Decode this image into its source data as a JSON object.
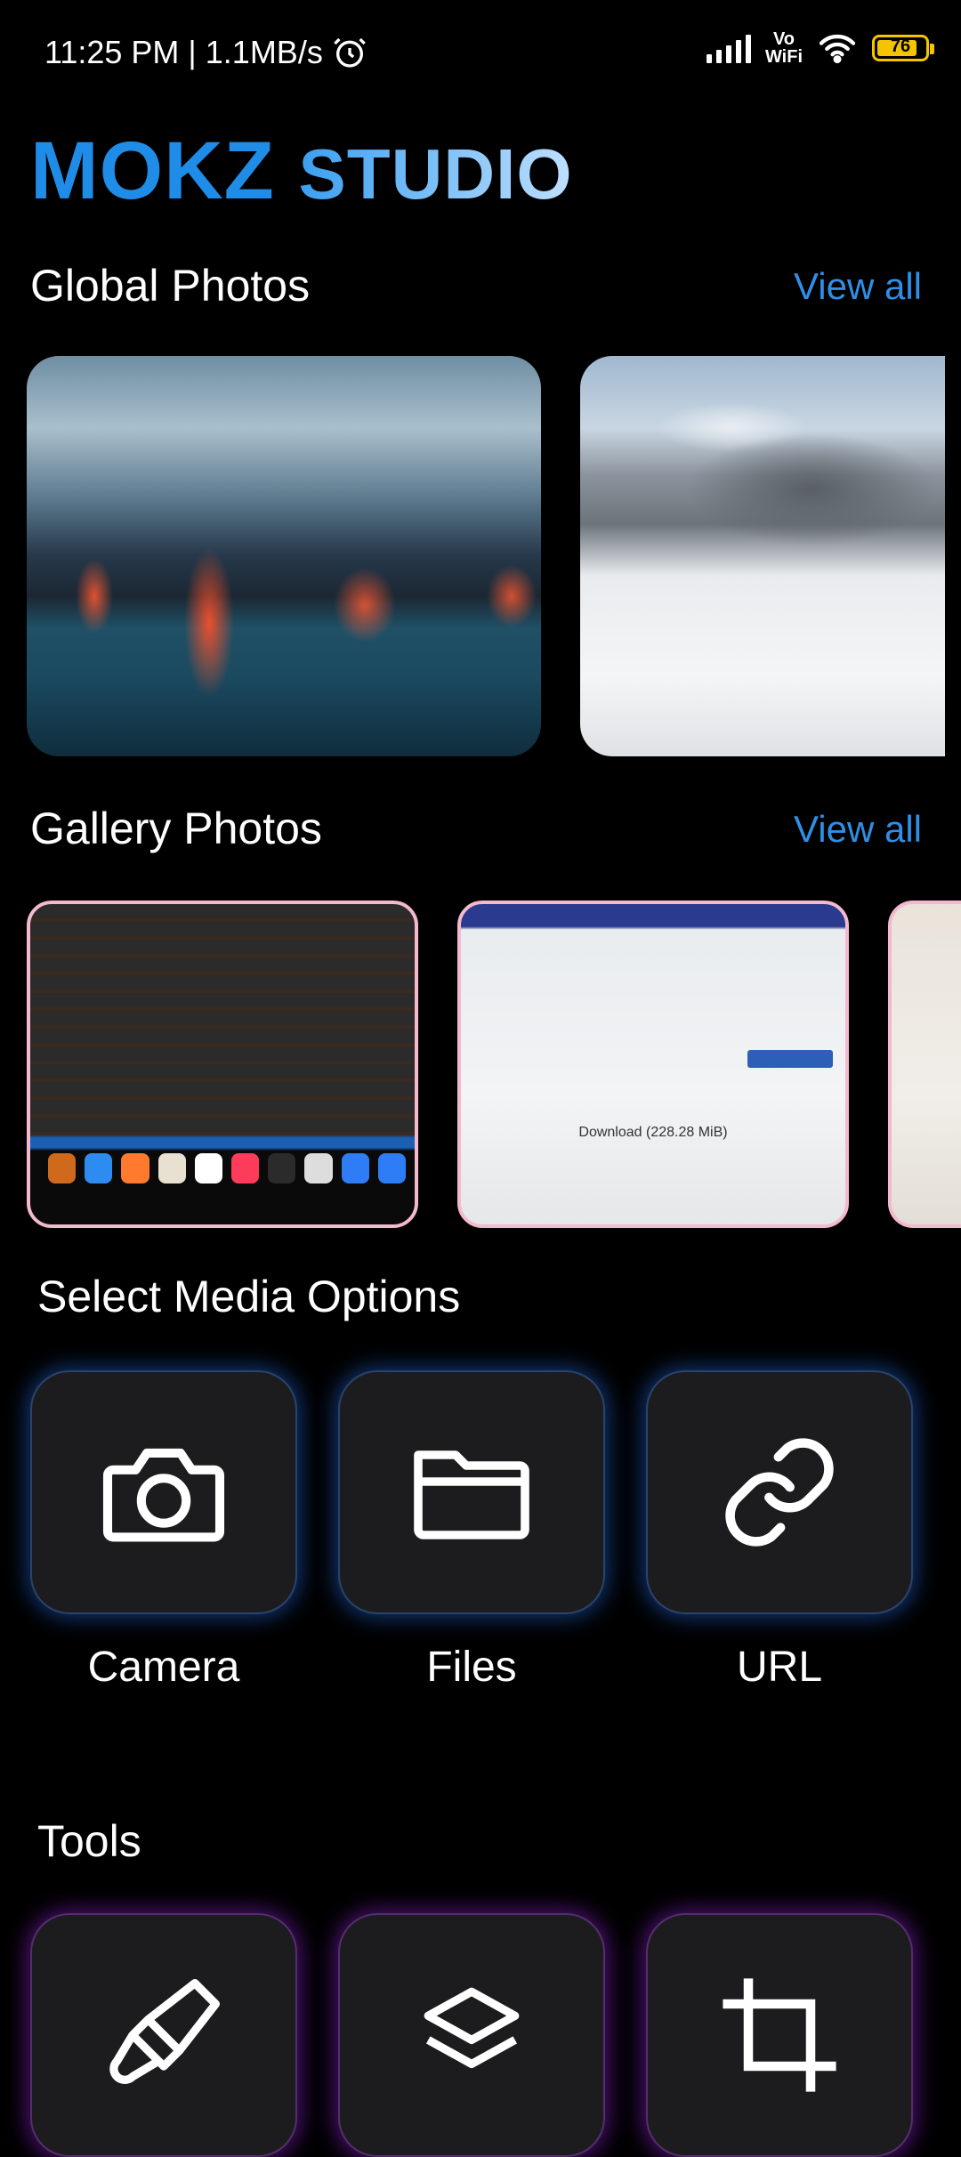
{
  "status_bar": {
    "time": "11:25 PM | 1.1MB/s",
    "network_label": "Vo\nWiFi",
    "battery": "76",
    "battery_level": 0.76
  },
  "app": {
    "title_part1": "MOKZ",
    "title_part2": "STUDIO"
  },
  "global_photos": {
    "title": "Global Photos",
    "view_all": "View all"
  },
  "gallery_photos": {
    "title": "Gallery Photos",
    "view_all": "View all",
    "card2_download": "Download (228.28 MiB)"
  },
  "media_options": {
    "title": "Select Media Options",
    "items": [
      {
        "label": "Camera",
        "icon": "camera-icon"
      },
      {
        "label": "Files",
        "icon": "folder-icon"
      },
      {
        "label": "URL",
        "icon": "link-icon"
      }
    ]
  },
  "tools": {
    "title": "Tools",
    "items": [
      {
        "icon": "paint-brush-icon"
      },
      {
        "icon": "layers-icon"
      },
      {
        "icon": "crop-icon"
      }
    ]
  },
  "colors": {
    "accent": "#2f8fe6",
    "tile_bg": "#1c1c1e",
    "media_glow": "#2878ff",
    "tools_glow": "#aa28ff",
    "gallery_border": "#f3b9cf"
  }
}
